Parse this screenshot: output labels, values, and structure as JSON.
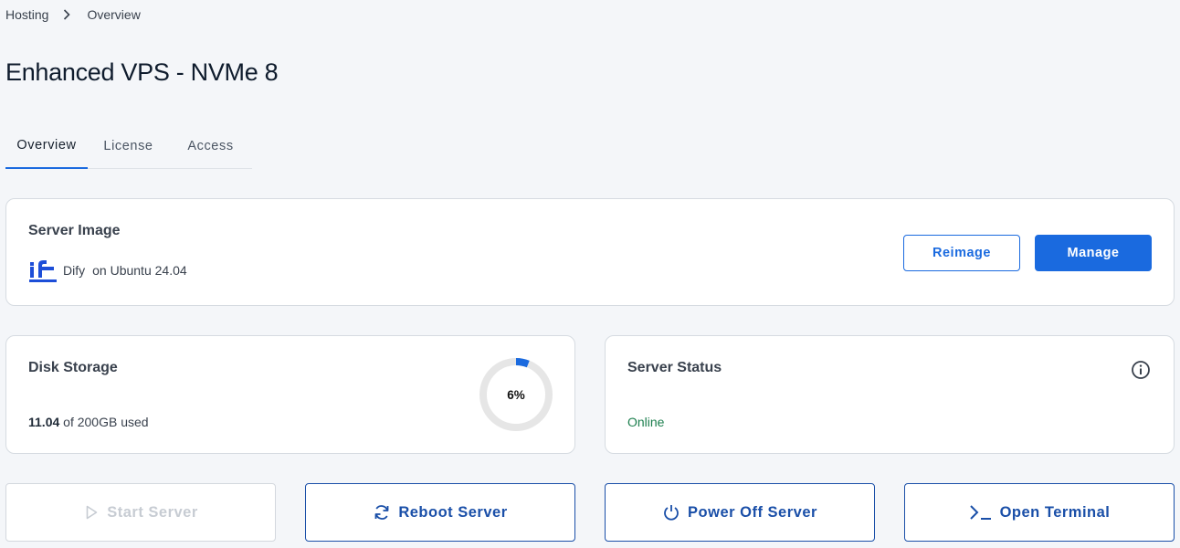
{
  "breadcrumb": {
    "items": [
      "Hosting",
      "Overview"
    ]
  },
  "page": {
    "title": "Enhanced VPS - NVMe 8"
  },
  "tabs": [
    {
      "label": "Overview",
      "active": true
    },
    {
      "label": "License",
      "active": false
    },
    {
      "label": "Access",
      "active": false
    }
  ],
  "server_image": {
    "title": "Server Image",
    "app_name": "Dify",
    "os_text": "on Ubuntu 24.04",
    "logo_icon": "dify-logo",
    "reimage_label": "Reimage",
    "manage_label": "Manage"
  },
  "disk": {
    "title": "Disk Storage",
    "used_value": "11.04",
    "used_suffix": "of 200GB used",
    "percent_label": "6%",
    "percent": 6
  },
  "status": {
    "title": "Server Status",
    "value": "Online",
    "info_icon": "info-icon"
  },
  "actions": [
    {
      "label": "Start Server",
      "icon": "play-icon",
      "enabled": false
    },
    {
      "label": "Reboot Server",
      "icon": "refresh-icon",
      "enabled": true
    },
    {
      "label": "Power Off Server",
      "icon": "power-icon",
      "enabled": true
    },
    {
      "label": "Open Terminal",
      "icon": "terminal-icon",
      "enabled": true
    }
  ],
  "colors": {
    "accent": "#1a6adf",
    "accent_dark": "#1a4fa8",
    "online": "#1c7f4e",
    "ring_track": "#e6e6e6",
    "disabled": "#c7ccd3"
  }
}
